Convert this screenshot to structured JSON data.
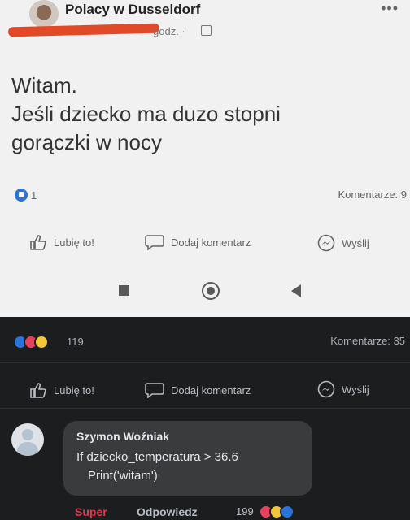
{
  "post": {
    "group_name": "Polacy w Dusseldorf",
    "time_text": "godz. ·",
    "text_lines": [
      "Witam.",
      "Jeśli dziecko ma duzo stopni",
      "gorączki w nocy"
    ],
    "like_count": "1",
    "comments_label": "Komentarze: 9"
  },
  "actions": {
    "like": "Lubię to!",
    "comment": "Dodaj komentarz",
    "send": "Wyślij"
  },
  "dark": {
    "reaction_count": "119",
    "comments_label": "Komentarze: 35"
  },
  "comment": {
    "author": "Szymon Woźniak",
    "line1": "If dziecko_temperatura > 36.6",
    "line2": "Print('witam')",
    "reaction_label": "Super",
    "reply_label": "Odpowiedz",
    "reaction_count": "199"
  },
  "colors": {
    "like_blue": "#2a73d8",
    "love_red": "#e8415e",
    "haha_yellow": "#f3c63a",
    "super_red": "#e0394f",
    "redaction": "#e04a28"
  },
  "icons": [
    "more-icon",
    "globe-icon",
    "like-thumb-icon",
    "comment-bubble-icon",
    "messenger-icon",
    "nav-square-icon",
    "nav-home-icon",
    "nav-back-icon"
  ]
}
